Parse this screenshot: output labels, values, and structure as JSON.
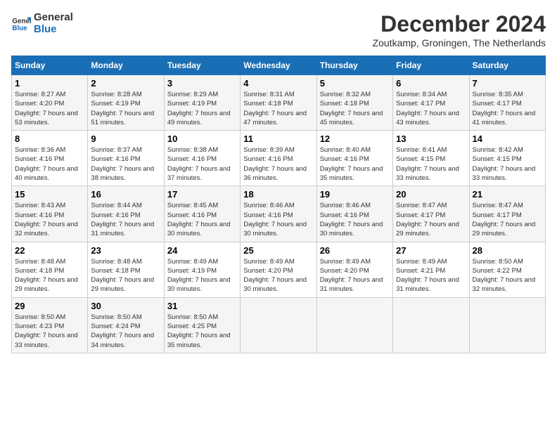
{
  "logo": {
    "line1": "General",
    "line2": "Blue"
  },
  "title": "December 2024",
  "location": "Zoutkamp, Groningen, The Netherlands",
  "days_of_week": [
    "Sunday",
    "Monday",
    "Tuesday",
    "Wednesday",
    "Thursday",
    "Friday",
    "Saturday"
  ],
  "weeks": [
    [
      {
        "day": "1",
        "sunrise": "8:27 AM",
        "sunset": "4:20 PM",
        "daylight": "7 hours and 53 minutes."
      },
      {
        "day": "2",
        "sunrise": "8:28 AM",
        "sunset": "4:19 PM",
        "daylight": "7 hours and 51 minutes."
      },
      {
        "day": "3",
        "sunrise": "8:29 AM",
        "sunset": "4:19 PM",
        "daylight": "7 hours and 49 minutes."
      },
      {
        "day": "4",
        "sunrise": "8:31 AM",
        "sunset": "4:18 PM",
        "daylight": "7 hours and 47 minutes."
      },
      {
        "day": "5",
        "sunrise": "8:32 AM",
        "sunset": "4:18 PM",
        "daylight": "7 hours and 45 minutes."
      },
      {
        "day": "6",
        "sunrise": "8:34 AM",
        "sunset": "4:17 PM",
        "daylight": "7 hours and 43 minutes."
      },
      {
        "day": "7",
        "sunrise": "8:35 AM",
        "sunset": "4:17 PM",
        "daylight": "7 hours and 41 minutes."
      }
    ],
    [
      {
        "day": "8",
        "sunrise": "8:36 AM",
        "sunset": "4:16 PM",
        "daylight": "7 hours and 40 minutes."
      },
      {
        "day": "9",
        "sunrise": "8:37 AM",
        "sunset": "4:16 PM",
        "daylight": "7 hours and 38 minutes."
      },
      {
        "day": "10",
        "sunrise": "8:38 AM",
        "sunset": "4:16 PM",
        "daylight": "7 hours and 37 minutes."
      },
      {
        "day": "11",
        "sunrise": "8:39 AM",
        "sunset": "4:16 PM",
        "daylight": "7 hours and 36 minutes."
      },
      {
        "day": "12",
        "sunrise": "8:40 AM",
        "sunset": "4:16 PM",
        "daylight": "7 hours and 35 minutes."
      },
      {
        "day": "13",
        "sunrise": "8:41 AM",
        "sunset": "4:15 PM",
        "daylight": "7 hours and 33 minutes."
      },
      {
        "day": "14",
        "sunrise": "8:42 AM",
        "sunset": "4:15 PM",
        "daylight": "7 hours and 33 minutes."
      }
    ],
    [
      {
        "day": "15",
        "sunrise": "8:43 AM",
        "sunset": "4:16 PM",
        "daylight": "7 hours and 32 minutes."
      },
      {
        "day": "16",
        "sunrise": "8:44 AM",
        "sunset": "4:16 PM",
        "daylight": "7 hours and 31 minutes."
      },
      {
        "day": "17",
        "sunrise": "8:45 AM",
        "sunset": "4:16 PM",
        "daylight": "7 hours and 30 minutes."
      },
      {
        "day": "18",
        "sunrise": "8:46 AM",
        "sunset": "4:16 PM",
        "daylight": "7 hours and 30 minutes."
      },
      {
        "day": "19",
        "sunrise": "8:46 AM",
        "sunset": "4:16 PM",
        "daylight": "7 hours and 30 minutes."
      },
      {
        "day": "20",
        "sunrise": "8:47 AM",
        "sunset": "4:17 PM",
        "daylight": "7 hours and 29 minutes."
      },
      {
        "day": "21",
        "sunrise": "8:47 AM",
        "sunset": "4:17 PM",
        "daylight": "7 hours and 29 minutes."
      }
    ],
    [
      {
        "day": "22",
        "sunrise": "8:48 AM",
        "sunset": "4:18 PM",
        "daylight": "7 hours and 29 minutes."
      },
      {
        "day": "23",
        "sunrise": "8:48 AM",
        "sunset": "4:18 PM",
        "daylight": "7 hours and 29 minutes."
      },
      {
        "day": "24",
        "sunrise": "8:49 AM",
        "sunset": "4:19 PM",
        "daylight": "7 hours and 30 minutes."
      },
      {
        "day": "25",
        "sunrise": "8:49 AM",
        "sunset": "4:20 PM",
        "daylight": "7 hours and 30 minutes."
      },
      {
        "day": "26",
        "sunrise": "8:49 AM",
        "sunset": "4:20 PM",
        "daylight": "7 hours and 31 minutes."
      },
      {
        "day": "27",
        "sunrise": "8:49 AM",
        "sunset": "4:21 PM",
        "daylight": "7 hours and 31 minutes."
      },
      {
        "day": "28",
        "sunrise": "8:50 AM",
        "sunset": "4:22 PM",
        "daylight": "7 hours and 32 minutes."
      }
    ],
    [
      {
        "day": "29",
        "sunrise": "8:50 AM",
        "sunset": "4:23 PM",
        "daylight": "7 hours and 33 minutes."
      },
      {
        "day": "30",
        "sunrise": "8:50 AM",
        "sunset": "4:24 PM",
        "daylight": "7 hours and 34 minutes."
      },
      {
        "day": "31",
        "sunrise": "8:50 AM",
        "sunset": "4:25 PM",
        "daylight": "7 hours and 35 minutes."
      },
      null,
      null,
      null,
      null
    ]
  ],
  "labels": {
    "sunrise": "Sunrise:",
    "sunset": "Sunset:",
    "daylight": "Daylight:"
  }
}
